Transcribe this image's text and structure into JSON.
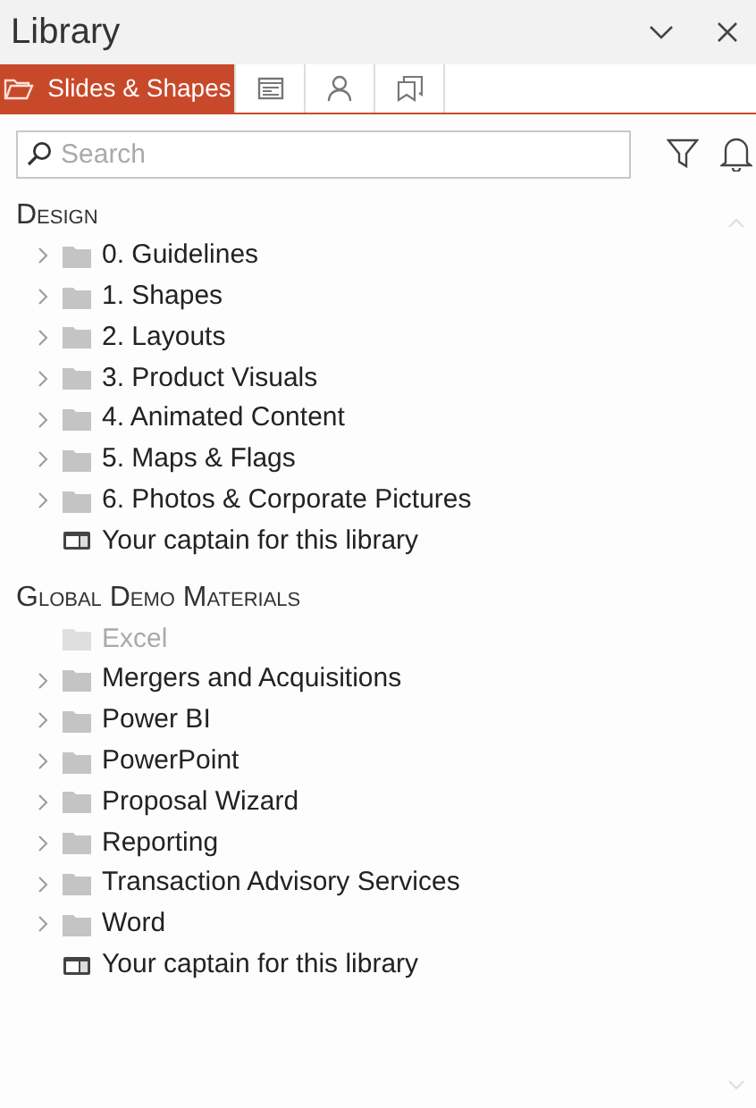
{
  "window": {
    "title": "Library"
  },
  "tabs": [
    {
      "kind": "folder",
      "label": "Slides & Shapes",
      "selected": true
    },
    {
      "kind": "slide",
      "selected": false
    },
    {
      "kind": "person",
      "selected": false
    },
    {
      "kind": "bookmarks",
      "selected": false
    }
  ],
  "search": {
    "placeholder": "Search"
  },
  "sections": [
    {
      "heading": "Design",
      "items": [
        {
          "kind": "folder",
          "label": "0. Guidelines",
          "expandable": true,
          "disabled": false
        },
        {
          "kind": "folder",
          "label": "1. Shapes",
          "expandable": true,
          "disabled": false
        },
        {
          "kind": "folder",
          "label": "2. Layouts",
          "expandable": true,
          "disabled": false
        },
        {
          "kind": "folder",
          "label": "3. Product Visuals",
          "expandable": true,
          "disabled": false
        },
        {
          "kind": "folder",
          "label": "4. Animated Content",
          "expandable": true,
          "disabled": false
        },
        {
          "kind": "folder",
          "label": "5. Maps & Flags",
          "expandable": true,
          "disabled": false
        },
        {
          "kind": "folder",
          "label": "6. Photos & Corporate Pictures",
          "expandable": true,
          "disabled": false
        },
        {
          "kind": "info",
          "label": "Your captain for this library",
          "expandable": false,
          "disabled": false
        }
      ]
    },
    {
      "heading": "Global Demo Materials",
      "items": [
        {
          "kind": "folder",
          "label": "Excel",
          "expandable": false,
          "disabled": true
        },
        {
          "kind": "folder",
          "label": "Mergers and Acquisitions",
          "expandable": true,
          "disabled": false
        },
        {
          "kind": "folder",
          "label": "Power BI",
          "expandable": true,
          "disabled": false
        },
        {
          "kind": "folder",
          "label": "PowerPoint",
          "expandable": true,
          "disabled": false
        },
        {
          "kind": "folder",
          "label": "Proposal Wizard",
          "expandable": true,
          "disabled": false
        },
        {
          "kind": "folder",
          "label": "Reporting",
          "expandable": true,
          "disabled": false
        },
        {
          "kind": "folder",
          "label": "Transaction Advisory Services",
          "expandable": true,
          "disabled": false
        },
        {
          "kind": "folder",
          "label": "Word",
          "expandable": true,
          "disabled": false
        },
        {
          "kind": "info",
          "label": "Your captain for this library",
          "expandable": false,
          "disabled": false
        }
      ]
    }
  ]
}
